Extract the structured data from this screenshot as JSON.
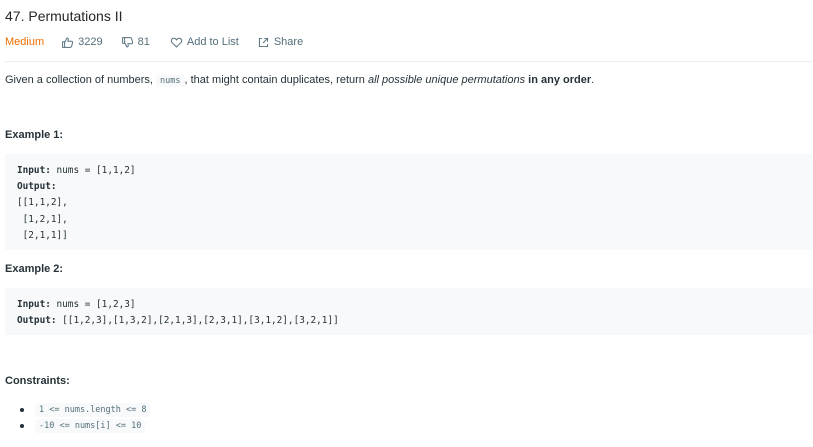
{
  "problem": {
    "title": "47. Permutations II",
    "difficulty": "Medium",
    "likes": "3229",
    "dislikes": "81",
    "add_to_list": "Add to List",
    "share": "Share"
  },
  "description": {
    "part1": "Given a collection of numbers, ",
    "code": "nums",
    "part2": ", that might contain duplicates, return ",
    "em": "all possible unique permutations",
    "strong": "in any order",
    "end": "."
  },
  "example1": {
    "heading": "Example 1:",
    "input_label": "Input:",
    "input_value": " nums = [1,1,2]",
    "output_label": "Output:",
    "output_lines": [
      "[[1,1,2],",
      " [1,2,1],",
      " [2,1,1]]"
    ]
  },
  "example2": {
    "heading": "Example 2:",
    "input_label": "Input:",
    "input_value": " nums = [1,2,3]",
    "output_label": "Output:",
    "output_value": " [[1,2,3],[1,3,2],[2,1,3],[2,3,1],[3,1,2],[3,2,1]]"
  },
  "constraints": {
    "heading": "Constraints:",
    "items": [
      "1 <= nums.length <= 8",
      "-10 <= nums[i] <= 10"
    ]
  },
  "colors": {
    "difficulty_medium": "#ef6c00",
    "meta_text": "#546e7a",
    "code_bg": "#f7f9fa"
  },
  "icons": [
    "thumbs-up-icon",
    "thumbs-down-icon",
    "heart-icon",
    "share-icon"
  ]
}
